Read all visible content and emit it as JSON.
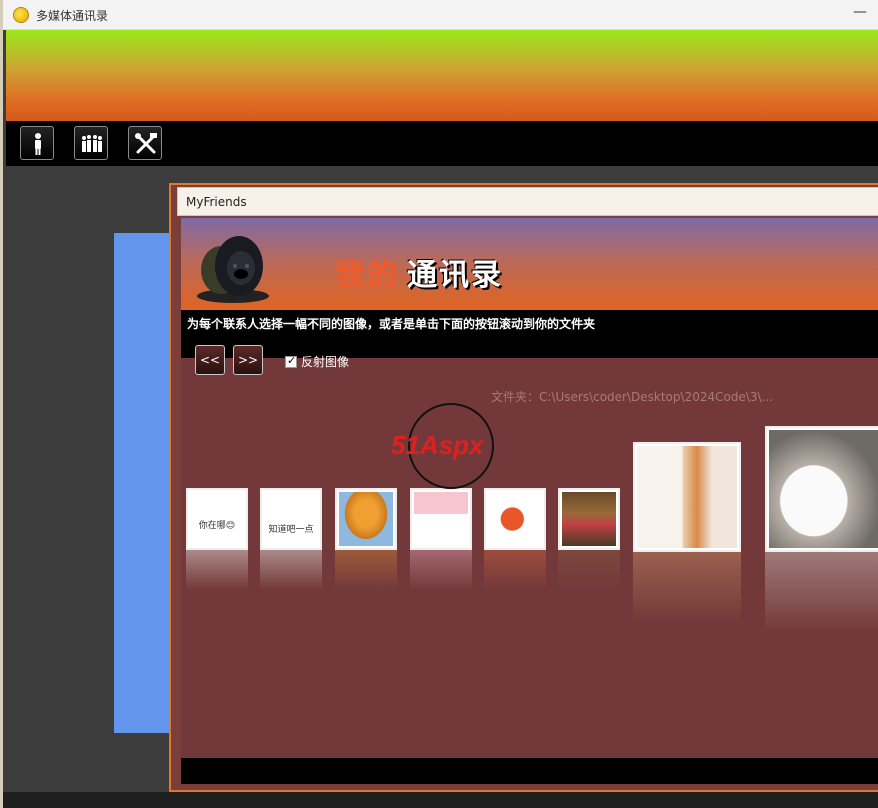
{
  "window": {
    "title": "多媒体通讯录",
    "minimize_glyph": "—"
  },
  "toolbar": {
    "buttons": [
      {
        "icon": "single-person-icon"
      },
      {
        "icon": "group-people-icon"
      },
      {
        "icon": "tools-icon"
      }
    ]
  },
  "child_window": {
    "title": "MyFriends",
    "heading_part1": "我的",
    "heading_part2": "通讯录",
    "instruction": "为每个联系人选择一幅不同的图像，或者是单击下面的按钮滚动到你的文件夹",
    "prev_label": "<<",
    "next_label": ">>",
    "reflect_label": "反射图像",
    "reflect_checked": true,
    "folder_label": "文件夹：C:\\Users\\coder\\Desktop\\2024Code\\3\\...",
    "thumbnails": [
      {
        "caption": "你在哪😊",
        "kind": "text"
      },
      {
        "caption": "知道吧一点",
        "kind": "text"
      },
      {
        "caption": "",
        "kind": "tree"
      },
      {
        "caption": "",
        "kind": "cartoon"
      },
      {
        "caption": "",
        "kind": "fox"
      },
      {
        "caption": "",
        "kind": "photo"
      },
      {
        "caption": "",
        "kind": "person"
      },
      {
        "caption": "",
        "kind": "mug"
      }
    ]
  },
  "watermark": {
    "text": "51Aspx"
  },
  "colors": {
    "accent_orange": "#e07a2a",
    "content_bg": "#73393a",
    "blue_panel": "#6495ed"
  }
}
